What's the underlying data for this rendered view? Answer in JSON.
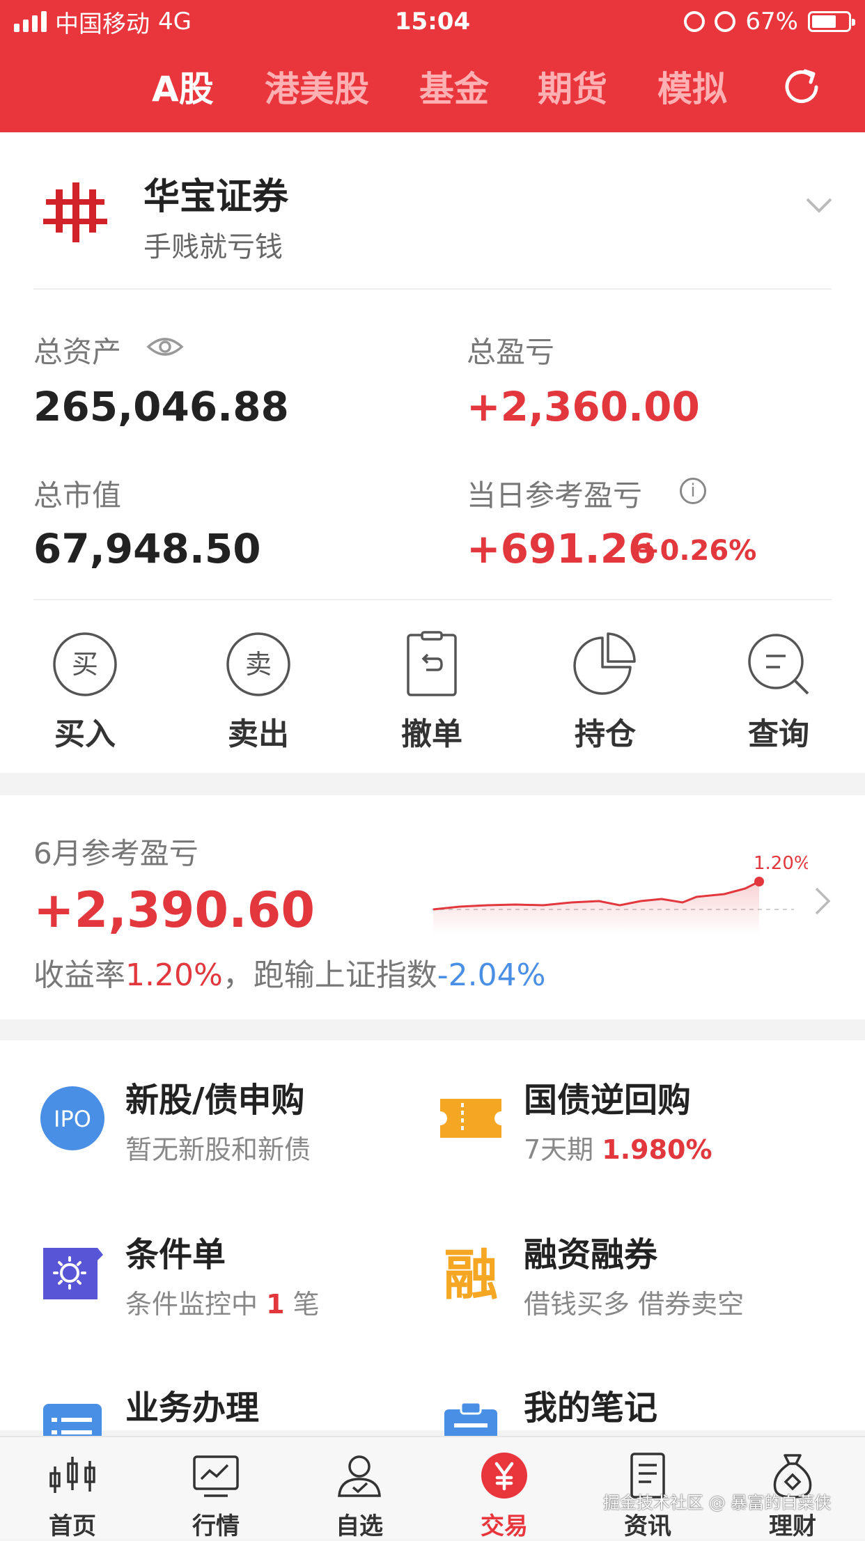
{
  "status_bar": {
    "carrier": "中国移动",
    "network": "4G",
    "time": "15:04",
    "battery": "67%"
  },
  "top_tabs": [
    "A股",
    "港美股",
    "基金",
    "期货",
    "模拟"
  ],
  "account": {
    "broker_name": "华宝证券",
    "subtitle": "手贱就亏钱",
    "total_assets_label": "总资产",
    "total_assets": "265,046.88",
    "total_pnl_label": "总盈亏",
    "total_pnl": "+2,360.00",
    "market_value_label": "总市值",
    "market_value": "67,948.50",
    "daily_pnl_label": "当日参考盈亏",
    "daily_pnl": "+691.26",
    "daily_pnl_pct": "+0.26%"
  },
  "actions": [
    {
      "label": "买入",
      "glyph": "买",
      "icon": "buy-icon"
    },
    {
      "label": "卖出",
      "glyph": "卖",
      "icon": "sell-icon"
    },
    {
      "label": "撤单",
      "icon": "cancel-order-icon"
    },
    {
      "label": "持仓",
      "icon": "pie-chart-icon"
    },
    {
      "label": "查询",
      "icon": "search-icon"
    }
  ],
  "monthly": {
    "label": "6月参考盈亏",
    "value": "+2,390.60",
    "desc_prefix": "收益率",
    "return_rate": "1.20%",
    "desc_mid": "，跑输上证指数",
    "vs_index": "-2.04%",
    "chart_peak_label": "1.20%"
  },
  "features": [
    {
      "title": "新股/债申购",
      "subtitle": "暂无新股和新债",
      "icon": "ipo-icon",
      "icon_text": "IPO"
    },
    {
      "title": "国债逆回购",
      "subtitle_prefix": "7天期 ",
      "subtitle_value": "1.980%",
      "icon": "ticket-icon"
    },
    {
      "title": "条件单",
      "subtitle_prefix": "条件监控中 ",
      "subtitle_value": "1",
      "subtitle_suffix": " 笔",
      "icon": "condition-order-icon"
    },
    {
      "title": "融资融券",
      "subtitle": "借钱买多 借券卖空",
      "icon": "margin-icon",
      "icon_text": "融"
    },
    {
      "title": "业务办理",
      "icon": "business-icon"
    },
    {
      "title": "我的笔记",
      "icon": "notes-icon"
    }
  ],
  "bottom_tabs": [
    {
      "label": "首页",
      "icon": "candlestick-icon"
    },
    {
      "label": "行情",
      "icon": "market-chart-icon"
    },
    {
      "label": "自选",
      "icon": "user-watchlist-icon"
    },
    {
      "label": "交易",
      "icon": "yuan-icon",
      "active": true
    },
    {
      "label": "资讯",
      "icon": "news-icon"
    },
    {
      "label": "理财",
      "icon": "money-bag-icon"
    }
  ],
  "watermark": "掘金技术社区 @ 暴富的白菜侠",
  "colors": {
    "brand_red": "#e9363d",
    "gain_red": "#e1373d",
    "loss_blue": "#4a8fe6",
    "accent_orange": "#f5a623",
    "accent_purple": "#5856d6"
  }
}
